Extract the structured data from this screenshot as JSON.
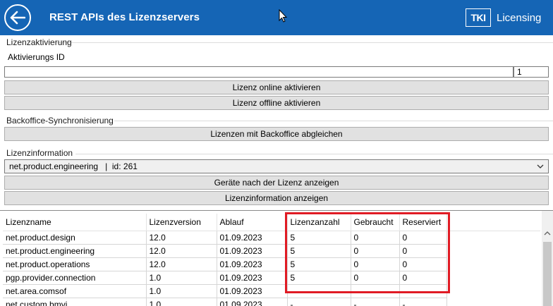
{
  "header": {
    "title": "REST APIs des Lizenzservers",
    "brand_logo": "TKI",
    "brand_text": "Licensing",
    "colors": {
      "bar": "#1565b5",
      "highlight": "#e01b24"
    }
  },
  "activation": {
    "group_label": "Lizenzaktivierung",
    "field_label": "Aktivierungs ID",
    "id_value": "",
    "count_value": "1",
    "online_button": "Lizenz online aktivieren",
    "offline_button": "Lizenz offline aktivieren"
  },
  "sync": {
    "group_label": "Backoffice-Synchronisierung",
    "button": "Lizenzen mit Backoffice abgleichen"
  },
  "info": {
    "group_label": "Lizenzinformation",
    "selected": "net.product.engineering   |  id: 261",
    "devices_button": "Geräte nach der Lizenz anzeigen",
    "show_button": "Lizenzinformation anzeigen"
  },
  "table": {
    "columns": [
      "Lizenzname",
      "Lizenzversion",
      "Ablauf",
      "Lizenzanzahl",
      "Gebraucht",
      "Reserviert"
    ],
    "rows": [
      [
        "net.product.design",
        "12.0",
        "01.09.2023",
        "5",
        "0",
        "0"
      ],
      [
        "net.product.engineering",
        "12.0",
        "01.09.2023",
        "5",
        "0",
        "0"
      ],
      [
        "net.product.operations",
        "12.0",
        "01.09.2023",
        "5",
        "0",
        "0"
      ],
      [
        "pgp.provider.connection",
        "1.0",
        "01.09.2023",
        "5",
        "0",
        "0"
      ],
      [
        "net.area.comsof",
        "1.0",
        "01.09.2023",
        "-",
        "-",
        "-"
      ],
      [
        "net.custom.bmvi",
        "1.0",
        "01.09.2023",
        "-",
        "-",
        "-"
      ]
    ]
  }
}
